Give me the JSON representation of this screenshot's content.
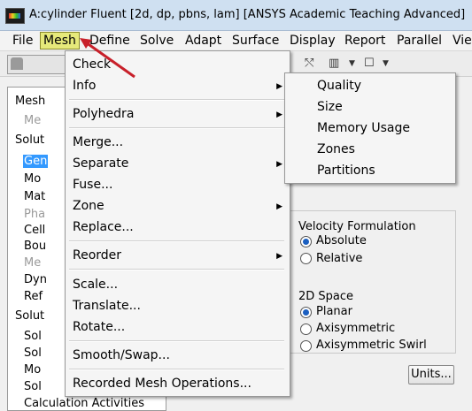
{
  "window": {
    "title": "A:cylinder Fluent  [2d, dp, pbns, lam] [ANSYS Academic Teaching Advanced]"
  },
  "menubar": {
    "items": [
      "File",
      "Mesh",
      "Define",
      "Solve",
      "Adapt",
      "Surface",
      "Display",
      "Report",
      "Parallel",
      "View"
    ]
  },
  "left_panel": {
    "items": [
      {
        "label": "Mesh",
        "style": "normal"
      },
      {
        "label": "Me",
        "style": "gray"
      },
      {
        "label": "Solut",
        "style": "normal"
      },
      {
        "label": "Gen",
        "style": "selected"
      },
      {
        "label": "Mo",
        "style": "normal"
      },
      {
        "label": "Mat",
        "style": "normal"
      },
      {
        "label": "Pha",
        "style": "gray"
      },
      {
        "label": "Cell",
        "style": "normal"
      },
      {
        "label": "Bou",
        "style": "normal"
      },
      {
        "label": "Me",
        "style": "gray"
      },
      {
        "label": "Dyn",
        "style": "normal"
      },
      {
        "label": "Ref",
        "style": "normal"
      },
      {
        "label": "Solut",
        "style": "normal"
      },
      {
        "label": "Sol",
        "style": "normal"
      },
      {
        "label": "Sol",
        "style": "normal"
      },
      {
        "label": "Mo",
        "style": "normal"
      },
      {
        "label": "Sol",
        "style": "normal"
      },
      {
        "label": "Calculation Activities",
        "style": "normal"
      }
    ]
  },
  "mesh_menu": {
    "items": [
      {
        "label": "Check",
        "submenu": false
      },
      {
        "label": "Info",
        "submenu": true
      },
      {
        "label": "Polyhedra",
        "submenu": true
      },
      {
        "label": "Merge...",
        "submenu": false
      },
      {
        "label": "Separate",
        "submenu": true
      },
      {
        "label": "Fuse...",
        "submenu": false
      },
      {
        "label": "Zone",
        "submenu": true
      },
      {
        "label": "Replace...",
        "submenu": false
      },
      {
        "label": "Reorder",
        "submenu": true
      },
      {
        "label": "Scale...",
        "submenu": false
      },
      {
        "label": "Translate...",
        "submenu": false
      },
      {
        "label": "Rotate...",
        "submenu": false
      },
      {
        "label": "Smooth/Swap...",
        "submenu": false
      },
      {
        "label": "Recorded Mesh Operations...",
        "submenu": false
      }
    ]
  },
  "info_submenu": {
    "items": [
      "Quality",
      "Size",
      "Memory Usage",
      "Zones",
      "Partitions"
    ]
  },
  "general_panel": {
    "velocity_formulation": {
      "heading": "Velocity Formulation",
      "options": [
        "Absolute",
        "Relative"
      ],
      "selected": "Absolute"
    },
    "space_2d": {
      "heading": "2D Space",
      "options": [
        "Planar",
        "Axisymmetric",
        "Axisymmetric Swirl"
      ],
      "selected": "Planar"
    },
    "units_button": "Units..."
  },
  "colors": {
    "menu_highlight": "#e6e97a",
    "selection": "#3399ff",
    "arrow": "#c8202a",
    "radio_dot": "#1b5fc0"
  },
  "icons": [
    "app-logo-icon",
    "mesh-display-icon",
    "axes-icon",
    "layout-icon",
    "window-icon",
    "chevron-down-icon",
    "submenu-arrow-icon",
    "pointer-arrow"
  ]
}
